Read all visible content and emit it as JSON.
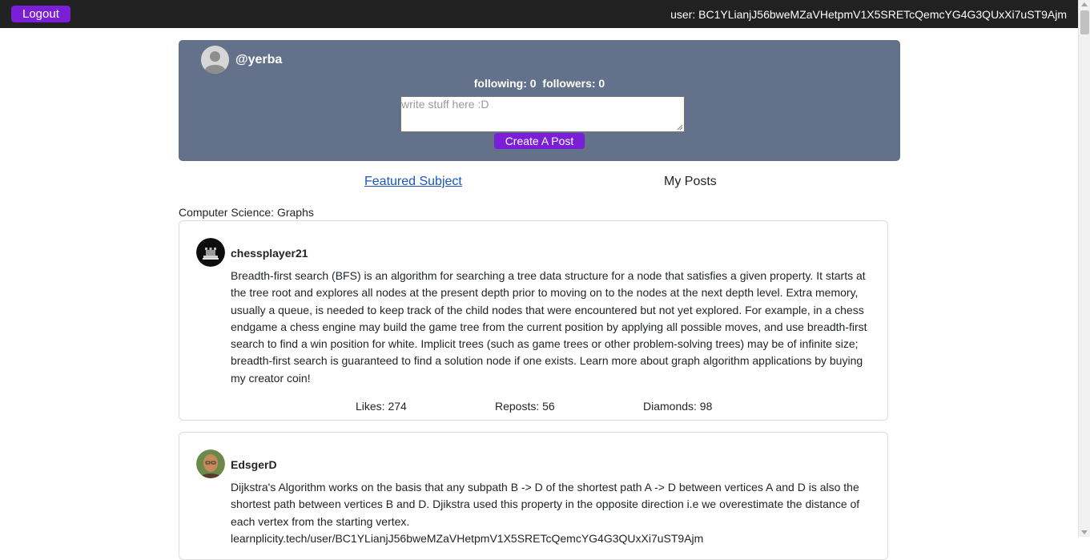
{
  "topbar": {
    "logout_label": "Logout",
    "user_text": "user: BC1YLianjJ56bweMZaVHetpmV1X5SRETcQemcYG4G3QUxXi7uST9Ajm"
  },
  "profile": {
    "handle": "@yerba",
    "following_text": "following: 0",
    "followers_text": "followers: 0",
    "post_placeholder": "write stuff here :D",
    "create_post_label": "Create A Post"
  },
  "tabs": {
    "featured_label": "Featured Subject",
    "my_posts_label": "My Posts"
  },
  "subject": "Computer Science: Graphs",
  "posts": [
    {
      "author": "chessplayer21",
      "body": "Breadth-first search (BFS) is an algorithm for searching a tree data structure for a node that satisfies a given property. It starts at the tree root and explores all nodes at the present depth prior to moving on to the nodes at the next depth level. Extra memory, usually a queue, is needed to keep track of the child nodes that were encountered but not yet explored. For example, in a chess endgame a chess engine may build the game tree from the current position by applying all possible moves, and use breadth-first search to find a win position for white. Implicit trees (such as game trees or other problem-solving trees) may be of infinite size; breadth-first search is guaranteed to find a solution node if one exists. Learn more about graph algorithm applications by buying my creator coin!",
      "likes": "Likes: 274",
      "reposts": "Reposts: 56",
      "diamonds": "Diamonds: 98"
    },
    {
      "author": "EdsgerD",
      "body": "Dijkstra's Algorithm works on the basis that any subpath B -> D of the shortest path A -> D between vertices A and D is also the shortest path between vertices B and D. Djikstra used this property in the opposite direction i.e we overestimate the distance of each vertex from the starting vertex.",
      "body_link": "learnplicity.tech/user/BC1YLianjJ56bweMZaVHetpmV1X5SRETcQemcYG4G3QUxXi7uST9Ajm"
    }
  ],
  "colors": {
    "topbar_bg": "#212121",
    "accent_purple": "#7b1fd6",
    "profile_card_bg": "#63728a",
    "link_blue": "#1a56c4"
  },
  "icons": {
    "profile_avatar": "default-user-avatar-icon",
    "post_1_avatar": "chess-piece-avatar",
    "post_2_avatar": "portrait-avatar"
  }
}
